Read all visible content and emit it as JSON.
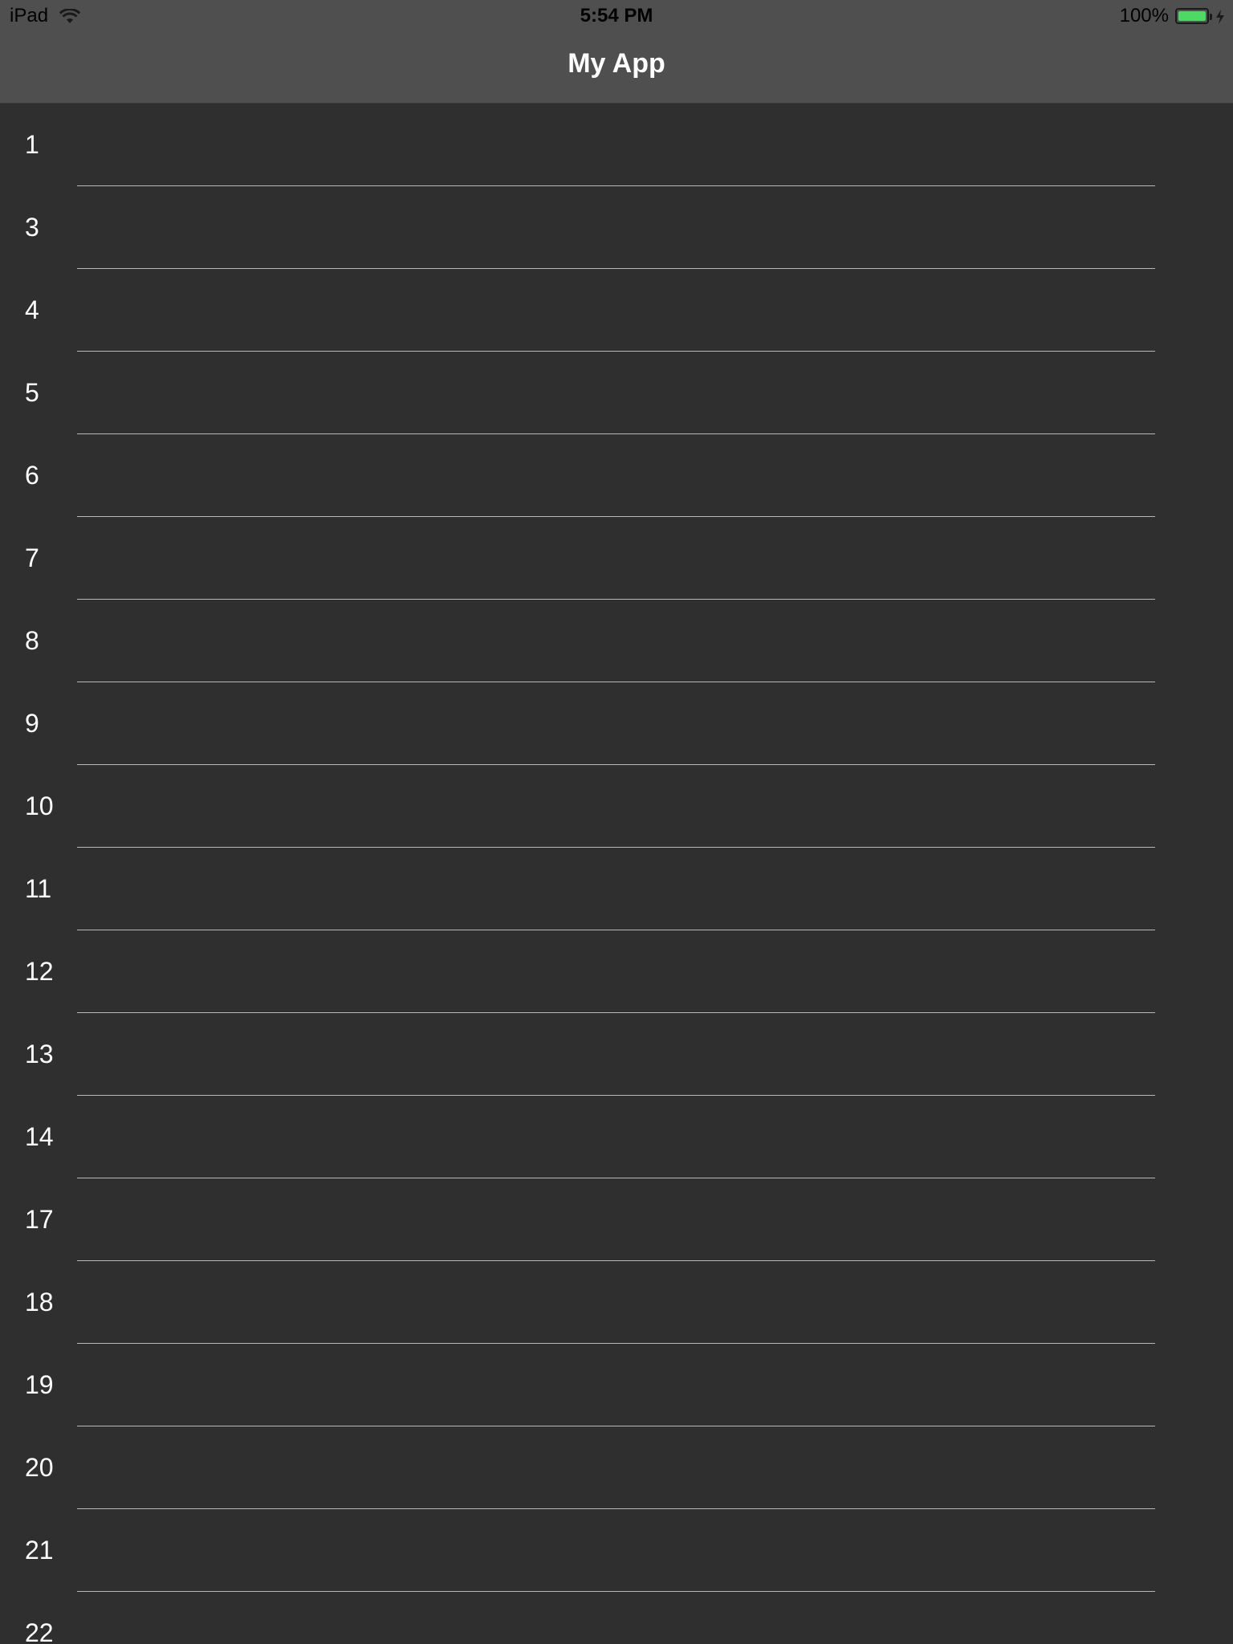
{
  "status_bar": {
    "device": "iPad",
    "time": "5:54 PM",
    "battery_percent": "100%",
    "battery_level": 1.0,
    "battery_color": "#4cd964",
    "icons": [
      "wifi-icon",
      "battery-icon",
      "charging-bolt-icon"
    ]
  },
  "nav": {
    "title": "My App"
  },
  "list": {
    "rows": [
      "1",
      "3",
      "4",
      "5",
      "6",
      "7",
      "8",
      "9",
      "10",
      "11",
      "12",
      "13",
      "14",
      "17",
      "18",
      "19",
      "20",
      "21",
      "22"
    ]
  },
  "colors": {
    "background": "#2f2f2f",
    "nav_background": "#4f4f4f",
    "separator": "#b8b8b8",
    "text": "#ffffff"
  }
}
